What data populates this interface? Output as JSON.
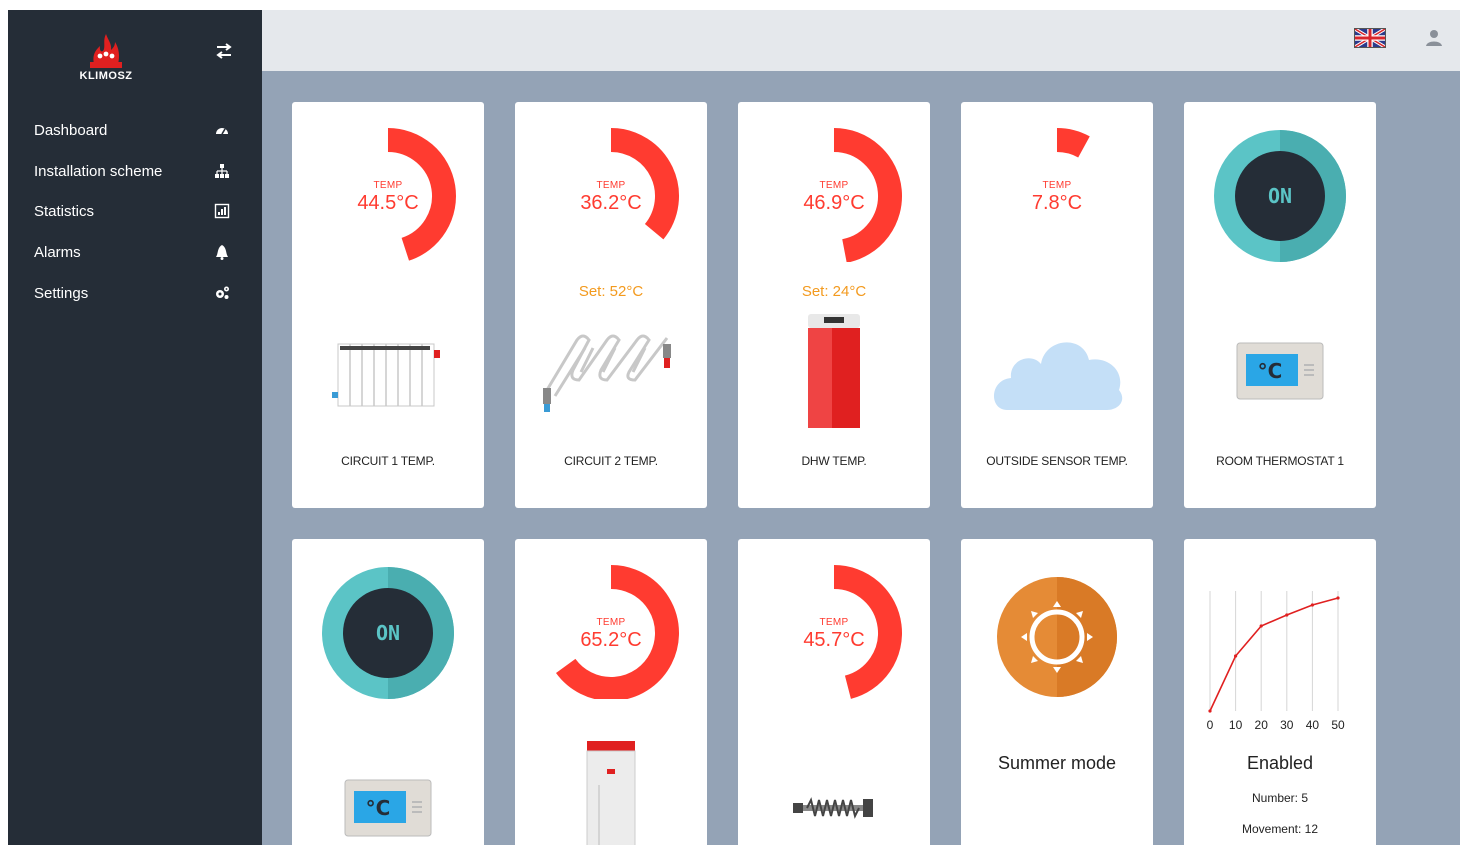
{
  "app": {
    "brand": "KLIMOSZ"
  },
  "sidebar": {
    "items": [
      {
        "label": "Dashboard",
        "icon": "dashboard-icon"
      },
      {
        "label": "Installation scheme",
        "icon": "sitemap-icon"
      },
      {
        "label": "Statistics",
        "icon": "chart-icon"
      },
      {
        "label": "Alarms",
        "icon": "bell-icon"
      },
      {
        "label": "Settings",
        "icon": "gears-icon"
      }
    ]
  },
  "topbar": {
    "language_icon": "uk-flag-icon",
    "user_icon": "user-icon"
  },
  "colors": {
    "accent_red": "#ff3b30",
    "set_orange": "#f39a1e",
    "thermostat_teal": "#5bc4c6",
    "sun_orange": "#e58b36",
    "sidebar_bg": "#252d37",
    "main_bg": "#94a3b6"
  },
  "tiles": [
    {
      "temp_label": "TEMP",
      "temp": "44.5°C",
      "level": 0.45,
      "set": "",
      "caption": "CIRCUIT 1 TEMP.",
      "icon": "radiator-icon"
    },
    {
      "temp_label": "TEMP",
      "temp": "36.2°C",
      "level": 0.36,
      "set": "Set: 52°C",
      "caption": "CIRCUIT 2 TEMP.",
      "icon": "floor-heating-icon"
    },
    {
      "temp_label": "TEMP",
      "temp": "46.9°C",
      "level": 0.47,
      "set": "Set: 24°C",
      "caption": "DHW TEMP.",
      "icon": "boiler-tank-icon"
    },
    {
      "temp_label": "TEMP",
      "temp": "7.8°C",
      "level": 0.08,
      "set": "",
      "caption": "OUTSIDE SENSOR TEMP.",
      "icon": "cloud-icon"
    },
    {
      "state": "ON",
      "caption": "ROOM THERMOSTAT 1",
      "icon": "thermostat-icon"
    },
    {
      "state": "ON",
      "caption": "",
      "icon": "thermostat-icon"
    },
    {
      "temp_label": "TEMP",
      "temp": "65.2°C",
      "level": 0.65,
      "set": "",
      "caption": "",
      "icon": "boiler-unit-icon"
    },
    {
      "temp_label": "TEMP",
      "temp": "45.7°C",
      "level": 0.46,
      "set": "",
      "caption": "",
      "icon": "heating-element-icon"
    },
    {
      "caption": "Summer mode",
      "icon": "sun-icon"
    },
    {
      "caption": "Enabled",
      "number": "Number: 5",
      "movement": "Movement: 12",
      "icon": "line-chart-icon"
    }
  ],
  "chart_data": {
    "type": "line",
    "x": [
      0,
      10,
      20,
      30,
      40,
      50
    ],
    "y": [
      0,
      55,
      85,
      96,
      106,
      113
    ],
    "xticks": [
      "0",
      "10",
      "20",
      "30",
      "40",
      "50"
    ],
    "xlim": [
      0,
      50
    ],
    "ylim": [
      0,
      120
    ],
    "grid": true,
    "title": "",
    "xlabel": "",
    "ylabel": ""
  }
}
